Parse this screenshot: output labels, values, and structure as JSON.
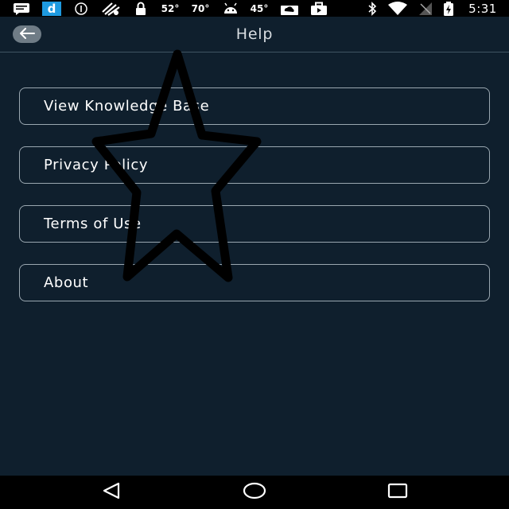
{
  "status_bar": {
    "temp_1": "52°",
    "temp_2": "70°",
    "temp_3": "45°",
    "time": "5:31",
    "icons": [
      "message-icon",
      "app-d-icon",
      "info-circle-icon",
      "wind-icon",
      "lock-icon",
      "android-icon",
      "cloud-icon",
      "briefcase-icon",
      "bluetooth-icon",
      "wifi-icon",
      "signal-icon",
      "battery-charging-icon"
    ]
  },
  "header": {
    "title": "Help",
    "back_icon": "arrow-left-icon"
  },
  "menu": {
    "items": [
      {
        "label": "View Knowledge Base"
      },
      {
        "label": "Privacy Policy"
      },
      {
        "label": "Terms of Use"
      },
      {
        "label": "About"
      }
    ]
  },
  "overlay": {
    "shape": "star-outline",
    "color": "#000000"
  },
  "nav_bar": {
    "icons": [
      "back-triangle-icon",
      "home-circle-icon",
      "recents-square-icon"
    ]
  },
  "colors": {
    "background": "#0f1f2d",
    "border": "#9aa7b0",
    "text": "#ffffff"
  }
}
